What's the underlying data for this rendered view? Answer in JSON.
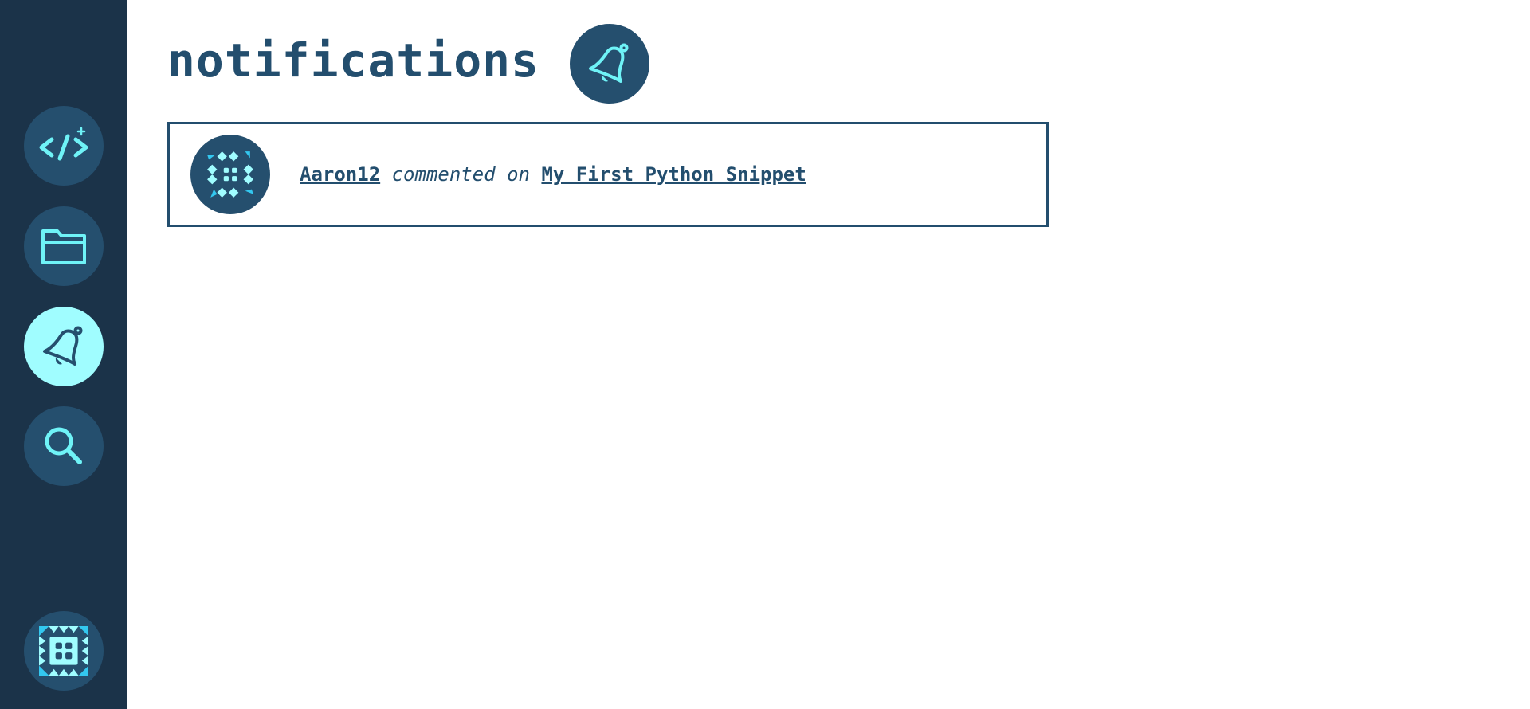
{
  "page": {
    "title": "notifications"
  },
  "colors": {
    "sidebar_bg": "#1b3349",
    "button_bg": "#254f6e",
    "active_bg": "#a0fdff",
    "accent": "#6ff3f7",
    "text": "#234e6e"
  },
  "sidebar": {
    "items": [
      {
        "icon": "new-snippet-icon",
        "active": false
      },
      {
        "icon": "folder-icon",
        "active": false
      },
      {
        "icon": "bell-icon",
        "active": true
      },
      {
        "icon": "search-icon",
        "active": false
      }
    ],
    "profile": {
      "icon": "identicon-avatar"
    }
  },
  "notifications": [
    {
      "user": "Aaron12",
      "action": "commented on",
      "target": "My First Python Snippet",
      "avatar_icon": "identicon-avatar"
    }
  ]
}
